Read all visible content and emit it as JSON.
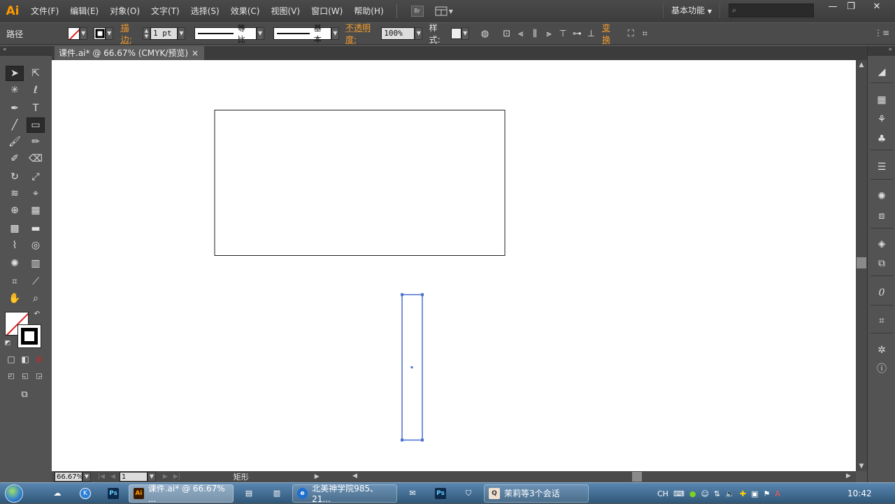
{
  "app": {
    "logo": "Ai"
  },
  "menu": [
    "文件(F)",
    "编辑(E)",
    "对象(O)",
    "文字(T)",
    "选择(S)",
    "效果(C)",
    "视图(V)",
    "窗口(W)",
    "帮助(H)"
  ],
  "bridge_label": "Br",
  "workspace": "基本功能",
  "search_placeholder": "",
  "window_controls": {
    "minimize": "—",
    "restore": "❐",
    "close": "✕"
  },
  "control": {
    "object_type": "路径",
    "stroke_label": "描边:",
    "stroke_weight": "1 pt",
    "profile_label": "等比",
    "brush_label": "基本",
    "opacity_label": "不透明度:",
    "opacity_value": "100%",
    "style_label": "样式:",
    "transform_label": "变换"
  },
  "document": {
    "tab_title": "课件.ai* @ 66.67% (CMYK/预览)",
    "close": "×"
  },
  "status": {
    "zoom": "66.67%",
    "artboard": "1",
    "tool_name": "矩形"
  },
  "taskbar": {
    "apps": [
      {
        "label": "课件.ai* @ 66.67% ...",
        "badge": "Ai"
      },
      {
        "label": "北美神学院985、21...",
        "badge": "e"
      },
      {
        "label": "茉莉等3个会话",
        "badge": "Q"
      }
    ],
    "ime": "CH",
    "clock": "10:42"
  },
  "colors": {
    "accent": "#f39c2c",
    "selection": "#4a6fd0",
    "canvas": "#ffffff",
    "chrome": "#535353"
  }
}
